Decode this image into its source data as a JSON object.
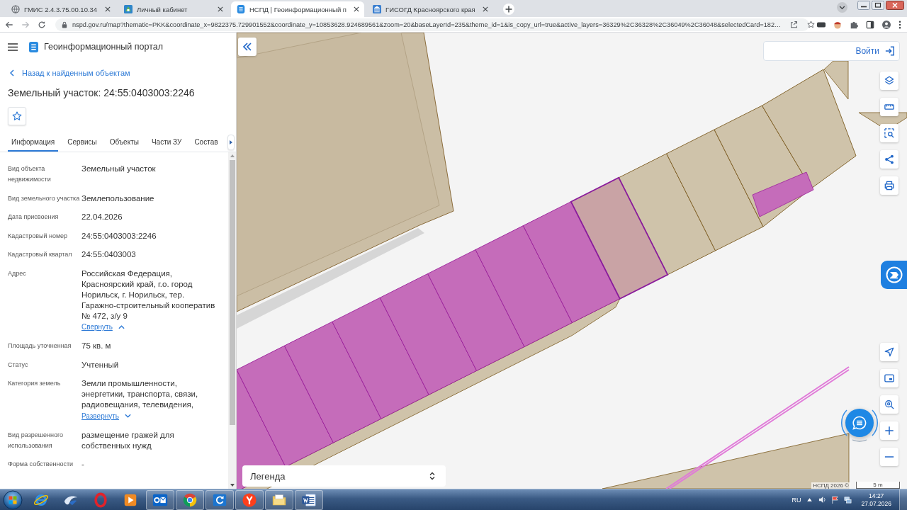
{
  "browser": {
    "tabs": [
      {
        "kind": "globe",
        "title": "ГМИС 2.4.3.75.00.10.34",
        "selected": false
      },
      {
        "kind": "emblem",
        "title": "Личный кабинет",
        "selected": false
      },
      {
        "kind": "portal",
        "title": "НСПД | Геоинформационный п",
        "selected": true
      },
      {
        "kind": "building",
        "title": "ГИСОГД Красноярского края",
        "selected": false
      }
    ],
    "url": "nspd.gov.ru/map?thematic=PKK&coordinate_x=9822375.729901552&coordinate_y=10853628.924689561&zoom=20&baseLayerId=235&theme_id=1&is_copy_url=true&active_layers=36329%2C36328%2C36049%2C36048&selectedCard=182…"
  },
  "portal": {
    "title": "Геоинформационный портал"
  },
  "card": {
    "back_link": "Назад к найденным объектам",
    "title": "Земельный участок: 24:55:0403003:2246",
    "favorited": false,
    "tabs": [
      {
        "label": "Информация",
        "selected": true
      },
      {
        "label": "Сервисы",
        "selected": false
      },
      {
        "label": "Объекты",
        "selected": false
      },
      {
        "label": "Части ЗУ",
        "selected": false
      },
      {
        "label": "Состав",
        "selected": false
      }
    ],
    "attributes": [
      {
        "label": "Вид объекта недвижимости",
        "value": "Земельный участок"
      },
      {
        "label": "Вид земельного участка",
        "value": "Землепользование"
      },
      {
        "label": "Дата присвоения",
        "value": "22.04.2026"
      },
      {
        "label": "Кадастровый номер",
        "value": "24:55:0403003:2246"
      },
      {
        "label": "Кадастровый квартал",
        "value": "24:55:0403003"
      },
      {
        "label": "Адрес",
        "value": "Российская Федерация,\nКрасноярский край, г.о. город\nНорильск, г. Норильск, тер.\nГаражно-строительный кооператив\n№ 472, з/у 9",
        "toggle": {
          "label": "Свернуть",
          "expanded": true
        }
      },
      {
        "label": "Площадь уточненная",
        "value": "75 кв. м"
      },
      {
        "label": "Статус",
        "value": "Учтенный"
      },
      {
        "label": "Категория земель",
        "value": "Земли промышленности,\nэнергетики, транспорта, связи,\nрадиовещания, телевидения,",
        "toggle": {
          "label": "Развернуть",
          "expanded": false
        }
      },
      {
        "label": "Вид разрешенного использования",
        "value": "размещение гражей для\nсобственных нужд"
      },
      {
        "label": "Форма собственности",
        "value": "-"
      }
    ]
  },
  "map": {
    "login": "Войти",
    "legend": "Легенда",
    "attribution": "НСПД 2026 ©",
    "scale": "5 m"
  },
  "taskbar": {
    "apps": [
      {
        "kind": "ie",
        "running": false
      },
      {
        "kind": "arrow",
        "running": false
      },
      {
        "kind": "opera",
        "running": false
      },
      {
        "kind": "player",
        "running": false
      },
      {
        "kind": "outlook",
        "running": true
      },
      {
        "kind": "chrome",
        "running": true
      },
      {
        "kind": "lync",
        "running": true
      },
      {
        "kind": "yandex",
        "running": true
      },
      {
        "kind": "explorer",
        "running": true
      },
      {
        "kind": "word",
        "running": true
      }
    ],
    "language": "RU",
    "time": "14:27",
    "date": "27.07.2026"
  }
}
